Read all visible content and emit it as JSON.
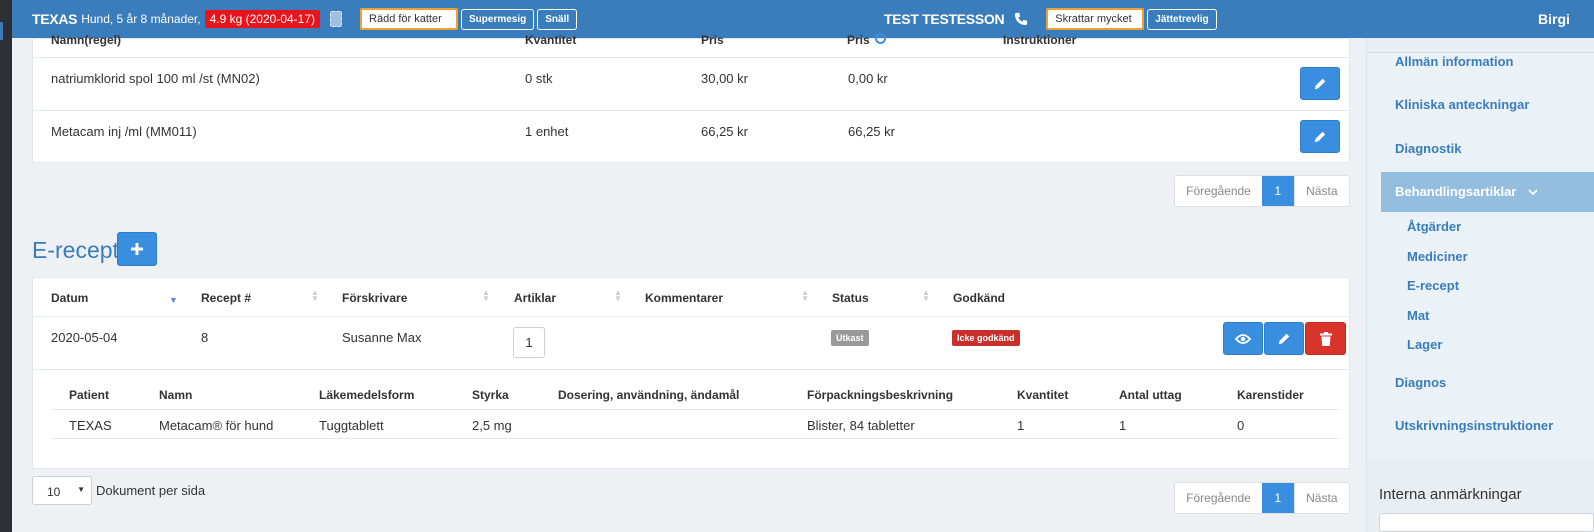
{
  "header": {
    "pet_name": "TEXAS",
    "pet_desc": "Hund, 5 år 8 månader,",
    "weight": "4.9 kg (2020-04-17)",
    "pet_note_input": "Rädd för katter",
    "pet_tags": [
      "Supermesig",
      "Snäll"
    ],
    "owner_name": "TEST TESTESSON",
    "owner_note_input": "Skrattar mycket",
    "owner_tags": [
      "Jättetrevlig"
    ],
    "user_name": "Birgi"
  },
  "articles": {
    "headers": [
      "Namn(regel)",
      "Kvantitet",
      "Pris",
      "Pris",
      "Instruktioner"
    ],
    "rows": [
      {
        "name": "natriumklorid spol 100 ml /st (MN02)",
        "qty": "0 stk",
        "price": "30,00 kr",
        "price2": "0,00 kr"
      },
      {
        "name": "Metacam inj /ml (MM011)",
        "qty": "1 enhet",
        "price": "66,25 kr",
        "price2": "66,25 kr"
      }
    ],
    "pager": {
      "prev": "Föregående",
      "page": "1",
      "next": "Nästa"
    }
  },
  "erecept": {
    "title": "E-recept",
    "headers": {
      "date": "Datum",
      "number": "Recept #",
      "prescriber": "Förskrivare",
      "articles": "Artiklar",
      "comments": "Kommentarer",
      "status": "Status",
      "approved": "Godkänd"
    },
    "row": {
      "date": "2020-05-04",
      "number": "8",
      "prescriber": "Susanne Max",
      "articles": "1",
      "status": "Utkast",
      "approved": "Icke godkänd"
    },
    "detail_headers": {
      "patient": "Patient",
      "name": "Namn",
      "form": "Läkemedelsform",
      "strength": "Styrka",
      "dosage": "Dosering, användning, ändamål",
      "package": "Förpackningsbeskrivning",
      "qty": "Kvantitet",
      "withdrawals": "Antal uttag",
      "withdrawal_time": "Karenstider"
    },
    "detail_row": {
      "patient": "TEXAS",
      "name": "Metacam® för hund",
      "form": "Tuggtablett",
      "strength": "2,5 mg",
      "dosage": "",
      "package": "Blister, 84 tabletter",
      "qty": "1",
      "withdrawals": "1",
      "withdrawal_time": "0"
    },
    "per_page_value": "10",
    "per_page_label": "Dokument per sida",
    "pager": {
      "prev": "Föregående",
      "page": "1",
      "next": "Nästa"
    }
  },
  "sidebar": {
    "items": [
      "Allmän information",
      "Kliniska anteckningar",
      "Diagnostik",
      "Behandlingsartiklar"
    ],
    "sub_items": [
      "Åtgärder",
      "Mediciner",
      "E-recept",
      "Mat",
      "Lager"
    ],
    "bottom_items": [
      "Diagnos",
      "Utskrivningsinstruktioner"
    ],
    "notes_title": "Interna anmärkningar"
  },
  "colors": {
    "primary": "#3a7dbd",
    "button": "#3a8ee0",
    "danger": "#d9342b",
    "weight": "#e8141b",
    "draft": "#999999"
  },
  "icons": {
    "edit": "pencil-icon",
    "view": "eye-icon",
    "delete": "trash-icon",
    "add": "plus-icon",
    "phone": "phone-icon",
    "chip": "microchip-icon"
  }
}
